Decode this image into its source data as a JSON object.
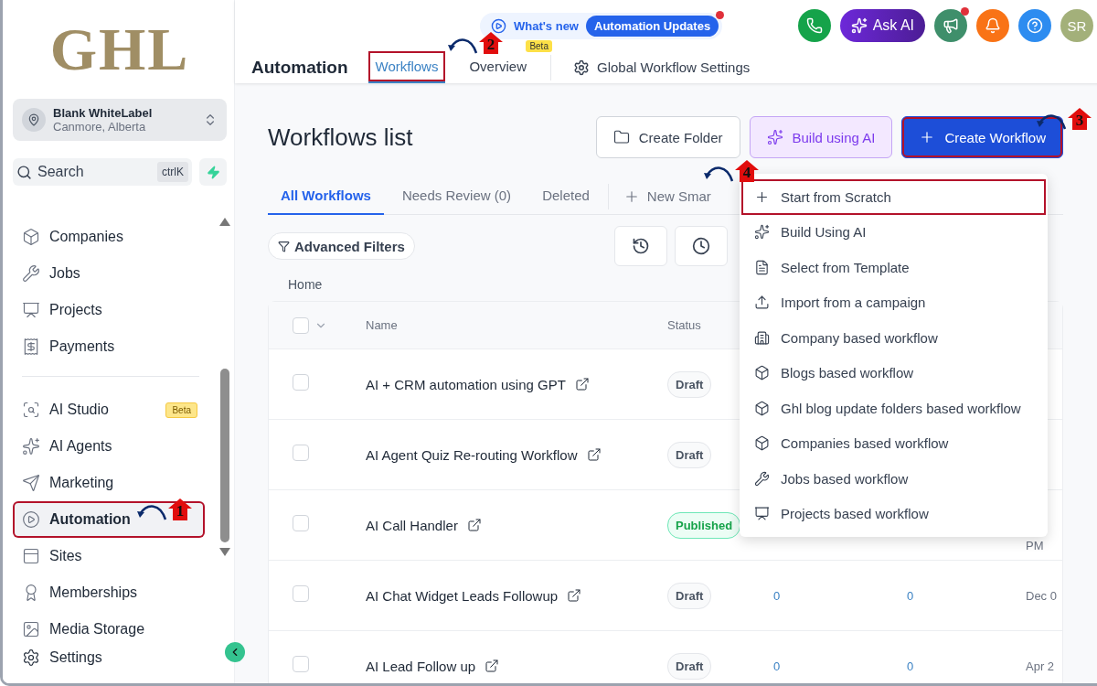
{
  "logo": "GHL",
  "account": {
    "name": "Blank WhiteLabel",
    "location": "Canmore, Alberta"
  },
  "search": {
    "placeholder": "Search",
    "shortcut": "ctrlK"
  },
  "nav_groups": [
    [
      {
        "label": "Companies",
        "selected": false,
        "highlighted": false
      },
      {
        "label": "Jobs",
        "selected": false,
        "highlighted": false
      },
      {
        "label": "Projects",
        "selected": false,
        "highlighted": false
      },
      {
        "label": "Payments",
        "selected": false,
        "highlighted": false
      }
    ],
    [
      {
        "label": "AI Studio",
        "badge": "Beta",
        "selected": false,
        "highlighted": false
      },
      {
        "label": "AI Agents",
        "selected": false,
        "highlighted": false
      },
      {
        "label": "Marketing",
        "selected": false,
        "highlighted": false
      },
      {
        "label": "Automation",
        "selected": true,
        "highlighted": true
      },
      {
        "label": "Sites",
        "selected": false,
        "highlighted": false
      },
      {
        "label": "Memberships",
        "selected": false,
        "highlighted": false
      },
      {
        "label": "Media Storage",
        "selected": false,
        "highlighted": false
      }
    ]
  ],
  "settings": "Settings",
  "whats_new": {
    "label": "What's new",
    "pill": "Automation Updates",
    "notification": true
  },
  "top_actions": [
    {
      "kind": "icon",
      "notification": false
    },
    {
      "kind": "ai",
      "label": "Ask AI",
      "notification": false
    },
    {
      "kind": "icon",
      "notification": true
    },
    {
      "kind": "icon",
      "notification": false
    },
    {
      "kind": "icon",
      "notification": false
    },
    {
      "kind": "avatar",
      "label": "SR",
      "notification": false
    }
  ],
  "section": "Automation",
  "tabs": [
    {
      "label": "Workflows",
      "selected": true,
      "highlighted": true
    },
    {
      "label": "Overview",
      "badge": "Beta",
      "selected": false,
      "highlighted": false
    }
  ],
  "global_settings": "Global Workflow Settings",
  "page_title": "Workflows list",
  "buttons": [
    {
      "kind": "outline",
      "label": "Create Folder",
      "highlighted": false
    },
    {
      "kind": "ai",
      "label": "Build using AI",
      "highlighted": false
    },
    {
      "kind": "primary",
      "label": "Create Workflow",
      "highlighted": true
    }
  ],
  "filter_tabs": [
    {
      "label": "All Workflows",
      "selected": true
    },
    {
      "label": "Needs Review (0)",
      "selected": false
    },
    {
      "label": "Deleted",
      "selected": false
    }
  ],
  "new_smart_list": "New Smar",
  "advanced_filters": "Advanced Filters",
  "breadcrumb": "Home",
  "table": {
    "select_all_checked": false,
    "columns": [
      "Name",
      "Status"
    ],
    "rows": [
      {
        "name": "AI + CRM automation using GPT",
        "status": "Draft",
        "kind": "draft",
        "checked": false
      },
      {
        "name": "AI Agent Quiz Re-routing Workflow",
        "status": "Draft",
        "kind": "draft",
        "checked": false
      },
      {
        "name": "AI Call Handler",
        "status": "Published",
        "kind": "published",
        "checked": false,
        "date": "PM"
      },
      {
        "name": "AI Chat Widget Leads Followup",
        "status": "Draft",
        "kind": "draft",
        "checked": false,
        "column_3": "0",
        "column_4": "0",
        "date": "Dec 0"
      },
      {
        "name": "AI Lead Follow up",
        "status": "Draft",
        "kind": "draft",
        "checked": false,
        "column_3": "0",
        "column_4": "0",
        "date": "Apr 2"
      }
    ]
  },
  "menu": [
    {
      "label": "Start from Scratch",
      "highlighted": true
    },
    {
      "label": "Build Using AI",
      "highlighted": false
    },
    {
      "label": "Select from Template",
      "highlighted": false
    },
    {
      "label": "Import from a campaign",
      "highlighted": false
    },
    {
      "label": "Company based workflow",
      "highlighted": false
    },
    {
      "label": "Blogs based workflow",
      "highlighted": false
    },
    {
      "label": "Ghl blog update folders based workflow",
      "highlighted": false
    },
    {
      "label": "Companies based workflow",
      "highlighted": false
    },
    {
      "label": "Jobs based workflow",
      "highlighted": false
    },
    {
      "label": "Projects based workflow",
      "highlighted": false
    }
  ],
  "callouts": [
    "1",
    "2",
    "3",
    "4"
  ]
}
